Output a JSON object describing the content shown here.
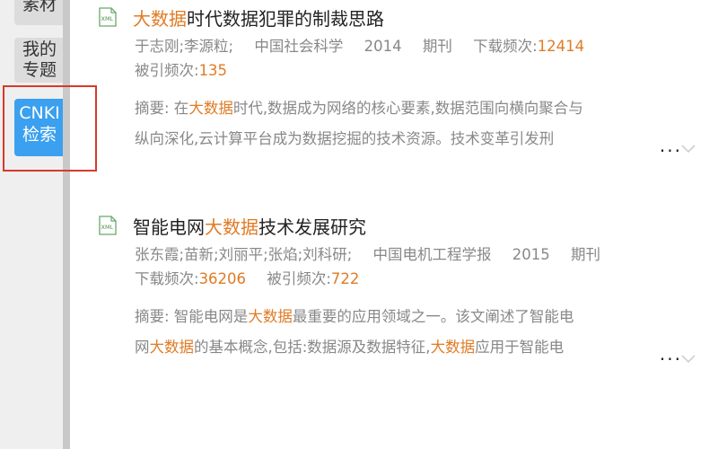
{
  "sidebar": {
    "tabs": [
      {
        "label_lines": [
          "素材"
        ]
      },
      {
        "label_lines": [
          "我的",
          "专题"
        ]
      },
      {
        "label_lines": [
          "CNKI",
          "检索"
        ],
        "active": true
      }
    ]
  },
  "results": [
    {
      "title_parts": [
        {
          "text": "大数据",
          "hl": true
        },
        {
          "text": "时代数据犯罪的制裁思路",
          "hl": false
        }
      ],
      "authors": "于志刚;李源粒;",
      "journal": "中国社会科学",
      "year": "2014",
      "type": "期刊",
      "downloads_label": "下载频次:",
      "downloads": "12414",
      "cited_label": "被引频次:",
      "cited": "135",
      "abstract_lines": [
        [
          {
            "text": "摘要: 在",
            "hl": false
          },
          {
            "text": "大数据",
            "hl": true
          },
          {
            "text": "时代,数据成为网络的核心要素,数据范围向横向聚合与",
            "hl": false
          }
        ],
        [
          {
            "text": "纵向深化,云计算平台成为数据挖掘的技术资源。技术变革引发刑",
            "hl": false
          }
        ]
      ],
      "more": "..."
    },
    {
      "title_parts": [
        {
          "text": "智能电网",
          "hl": false
        },
        {
          "text": "大数据",
          "hl": true
        },
        {
          "text": "技术发展研究",
          "hl": false
        }
      ],
      "authors": "张东霞;苗新;刘丽平;张焰;刘科研;",
      "journal": "中国电机工程学报",
      "year": "2015",
      "type": "期刊",
      "downloads_label": "下载频次:",
      "downloads": "36206",
      "cited_label": "被引频次:",
      "cited": "722",
      "abstract_lines": [
        [
          {
            "text": "摘要: 智能电网是",
            "hl": false
          },
          {
            "text": "大数据",
            "hl": true
          },
          {
            "text": "最重要的应用领域之一。该文阐述了智能电",
            "hl": false
          }
        ],
        [
          {
            "text": "网",
            "hl": false
          },
          {
            "text": "大数据",
            "hl": true
          },
          {
            "text": "的基本概念,包括:数据源及数据特征,",
            "hl": false
          },
          {
            "text": "大数据",
            "hl": true
          },
          {
            "text": "应用于智能电",
            "hl": false
          }
        ]
      ],
      "more": "..."
    }
  ],
  "icons": {
    "result_icon": "xml-file-icon",
    "expand_icon": "chevron-down-icon"
  },
  "colors": {
    "highlight": "#e07b24",
    "active_tab": "#3aa0ef",
    "annotation_box": "#d63a2c"
  }
}
